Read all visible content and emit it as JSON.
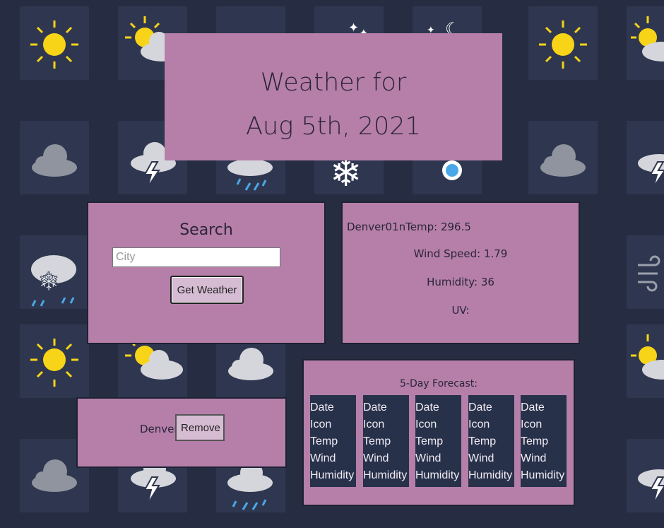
{
  "header": {
    "title_line1": "Weather for",
    "title_line2": "Aug 5th, 2021"
  },
  "search": {
    "heading": "Search",
    "placeholder": "City",
    "button_label": "Get Weather"
  },
  "current": {
    "city_temp": "Denver01nTemp: 296.5",
    "wind": "Wind Speed: 1.79",
    "humidity": "Humidity: 36",
    "uv": "UV:"
  },
  "history": {
    "items": [
      {
        "city": "Denver",
        "remove_label": "Remove"
      }
    ]
  },
  "forecast": {
    "heading": "5-Day Forecast:",
    "cards": [
      {
        "date": "Date",
        "icon": "Icon",
        "temp": "Temp",
        "wind": "Wind",
        "humidity": "Humidity"
      },
      {
        "date": "Date",
        "icon": "Icon",
        "temp": "Temp",
        "wind": "Wind",
        "humidity": "Humidity"
      },
      {
        "date": "Date",
        "icon": "Icon",
        "temp": "Temp",
        "wind": "Wind",
        "humidity": "Humidity"
      },
      {
        "date": "Date",
        "icon": "Icon",
        "temp": "Temp",
        "wind": "Wind",
        "humidity": "Humidity"
      },
      {
        "date": "Date",
        "icon": "Icon",
        "temp": "Temp",
        "wind": "Wind",
        "humidity": "Humidity"
      }
    ]
  },
  "background_icons": [
    "sun-icon",
    "partly-cloudy-icon",
    "cloud-icon",
    "thunderstorm-icon",
    "rain-icon",
    "snowflake-icon",
    "thermometer-icon",
    "snow-rain-icon",
    "wind-icon",
    "moon-stars-icon"
  ],
  "colors": {
    "background": "#262d42",
    "tile": "#2f3750",
    "panel": "#b57faa",
    "card": "#28314a",
    "sun": "#f7d417"
  }
}
